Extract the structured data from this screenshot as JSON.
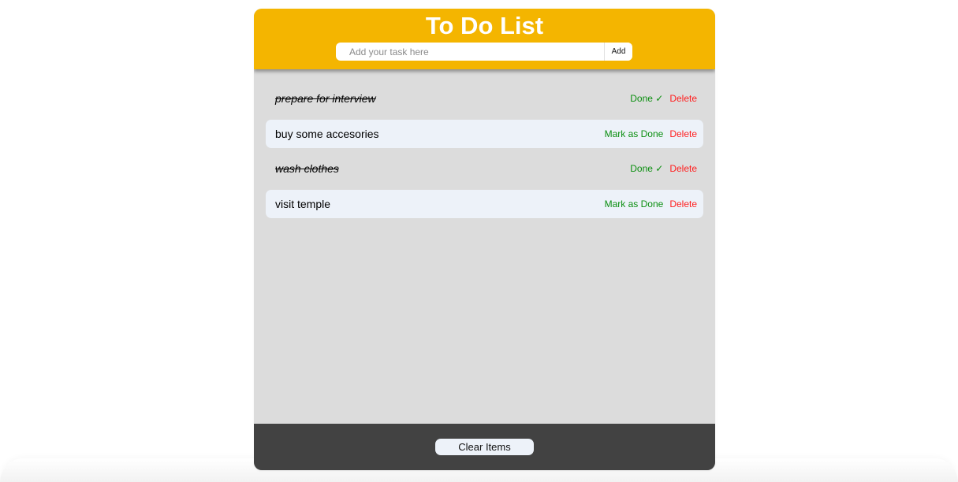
{
  "app": {
    "title": "To Do List"
  },
  "form": {
    "placeholder": "Add your task here",
    "value": "",
    "add_label": "Add"
  },
  "tasks": [
    {
      "text": "prepare for interview",
      "done": true,
      "status_label": "Done ✓",
      "delete_label": "Delete"
    },
    {
      "text": "buy some accesories",
      "done": false,
      "status_label": "Mark as Done",
      "delete_label": "Delete"
    },
    {
      "text": "wash clothes",
      "done": true,
      "status_label": "Done ✓",
      "delete_label": "Delete"
    },
    {
      "text": "visit temple",
      "done": false,
      "status_label": "Mark as Done",
      "delete_label": "Delete"
    }
  ],
  "footer": {
    "clear_label": "Clear Items"
  },
  "colors": {
    "header": "#f4b500",
    "list_background": "#dcdcdc",
    "pending_row": "#edf2f9",
    "done_action": "#0b8f10",
    "delete_action": "#ff1e1e",
    "footer": "#424242"
  }
}
